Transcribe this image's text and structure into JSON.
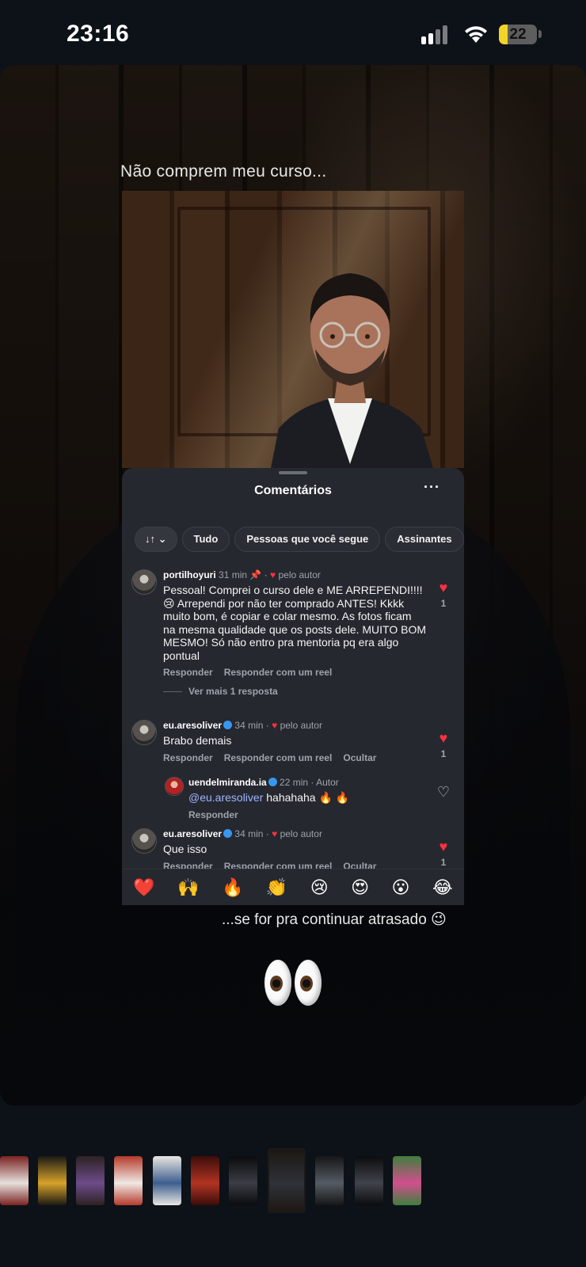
{
  "status_bar": {
    "time": "23:16",
    "battery_level": 22,
    "battery_label": "22"
  },
  "story": {
    "caption_top": "Não comprem meu curso...",
    "caption_bottom": "...se for pra continuar  atrasado 😉",
    "sticker_emoji": "👀"
  },
  "comments_sheet": {
    "title": "Comentários",
    "more_label": "···",
    "filters": [
      {
        "label": "↓↑ ⌄"
      },
      {
        "label": "Tudo"
      },
      {
        "label": "Pessoas que você segue"
      },
      {
        "label": "Assinantes"
      }
    ],
    "comments": [
      {
        "username": "portilhoyuri",
        "time": "31 min",
        "pinned": "📌",
        "by_author": "pelo autor",
        "text": "Pessoal! Comprei o curso dele e ME ARREPENDI!!!! 😢 Arrependi por não ter comprado ANTES! Kkkk muito bom, é copiar e colar mesmo. As fotos ficam na mesma qualidade que os posts dele. MUITO BOM MESMO! Só não entro pra mentoria pq era algo pontual",
        "reply": "Responder",
        "reply_reel": "Responder com um reel",
        "likes": "1",
        "see_more": "Ver mais 1 resposta"
      },
      {
        "username": "eu.aresoliver",
        "time": "34 min",
        "by_author": "pelo autor",
        "text": "Brabo demais",
        "reply": "Responder",
        "reply_reel": "Responder com um reel",
        "hide": "Ocultar",
        "likes": "1"
      },
      {
        "username": "uendelmiranda.ia",
        "time": "22 min",
        "author_tag": "Autor",
        "mention": "@eu.aresoliver",
        "text": " hahahaha 🔥 🔥",
        "reply": "Responder"
      },
      {
        "username": "eu.aresoliver",
        "time": "34 min",
        "by_author": "pelo autor",
        "text": "Que isso",
        "reply": "Responder",
        "reply_reel": "Responder com um reel",
        "hide": "Ocultar",
        "likes": "1"
      }
    ],
    "reactions": [
      "❤️",
      "🙌",
      "🔥",
      "👏",
      "😢",
      "😍",
      "😮",
      "😂"
    ]
  },
  "colors": {
    "like_red": "#ff3040",
    "verified_blue": "#3797f0",
    "sheet_bg": "#25282e",
    "battery_yellow": "#f2d327"
  },
  "thumbnails": [
    {
      "name": "thumb-1",
      "colors": [
        "#7a2320",
        "#e6e0dc"
      ]
    },
    {
      "name": "thumb-2",
      "colors": [
        "#1b1a14",
        "#d6a22b"
      ]
    },
    {
      "name": "thumb-3",
      "colors": [
        "#2c2222",
        "#6e4b8a"
      ]
    },
    {
      "name": "thumb-4",
      "colors": [
        "#b53a2a",
        "#efe9e4"
      ]
    },
    {
      "name": "thumb-5",
      "colors": [
        "#e9e6e1",
        "#3d5d8f"
      ]
    },
    {
      "name": "thumb-6",
      "colors": [
        "#3b0d0a",
        "#b23422"
      ]
    },
    {
      "name": "thumb-7",
      "colors": [
        "#0b0b0d",
        "#3a3d44"
      ]
    },
    {
      "name": "thumb-8",
      "colors": [
        "#1d1712",
        "#2f3239"
      ],
      "active": true
    },
    {
      "name": "thumb-9",
      "colors": [
        "#161616",
        "#555b64"
      ]
    },
    {
      "name": "thumb-10",
      "colors": [
        "#0c0c0e",
        "#40434b"
      ]
    },
    {
      "name": "thumb-11",
      "colors": [
        "#3f7f3c",
        "#d24f8f"
      ]
    }
  ]
}
